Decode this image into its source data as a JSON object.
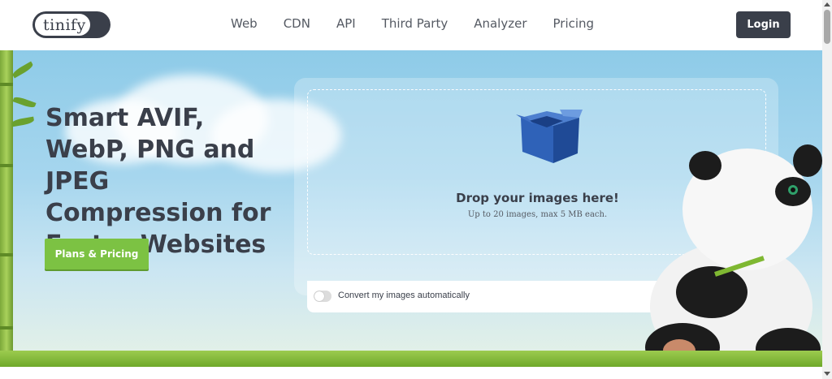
{
  "header": {
    "logo_text": "tinify",
    "nav": [
      "Web",
      "CDN",
      "API",
      "Third Party",
      "Analyzer",
      "Pricing"
    ],
    "login_label": "Login"
  },
  "hero": {
    "headline": "Smart AVIF, WebP, PNG and JPEG Compression for Faster Websites",
    "cta_label": "Plans & Pricing"
  },
  "dropzone": {
    "title": "Drop your images here!",
    "subtitle": "Up to 20 images, max 5 MB each.",
    "convert_label": "Convert my images automatically",
    "convert_enabled": false
  },
  "colors": {
    "dark": "#3a3f4a",
    "accent_green": "#7cc243",
    "sky": "#8ecbe8"
  },
  "icons": [
    "box-icon",
    "toggle-icon",
    "panda-mascot"
  ]
}
